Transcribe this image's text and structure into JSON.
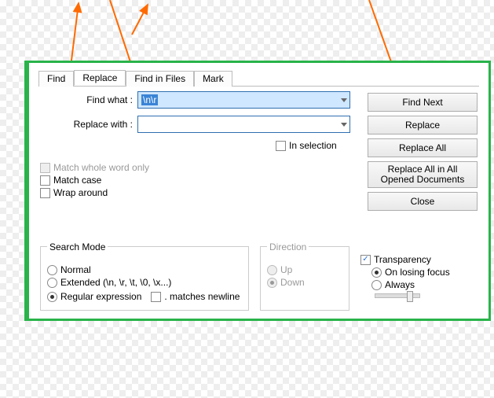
{
  "tabs": {
    "find": "Find",
    "replace": "Replace",
    "findInFiles": "Find in Files",
    "mark": "Mark"
  },
  "labels": {
    "findWhat": "Find what :",
    "replaceWith": "Replace with :"
  },
  "values": {
    "findWhat": "\\n\\r",
    "replaceWith": ""
  },
  "checks": {
    "inSelection": "In selection",
    "matchWhole": "Match whole word only",
    "matchCase": "Match case",
    "wrapAround": "Wrap around",
    "matchesNewline": ". matches newline"
  },
  "buttons": {
    "findNext": "Find Next",
    "replace": "Replace",
    "replaceAll": "Replace All",
    "replaceAllOpen": "Replace All in All Opened Documents",
    "close": "Close"
  },
  "searchMode": {
    "legend": "Search Mode",
    "normal": "Normal",
    "extended": "Extended (\\n, \\r, \\t, \\0, \\x...)",
    "regex": "Regular expression"
  },
  "direction": {
    "legend": "Direction",
    "up": "Up",
    "down": "Down"
  },
  "transparency": {
    "legend": "Transparency",
    "onLosing": "On losing focus",
    "always": "Always"
  }
}
